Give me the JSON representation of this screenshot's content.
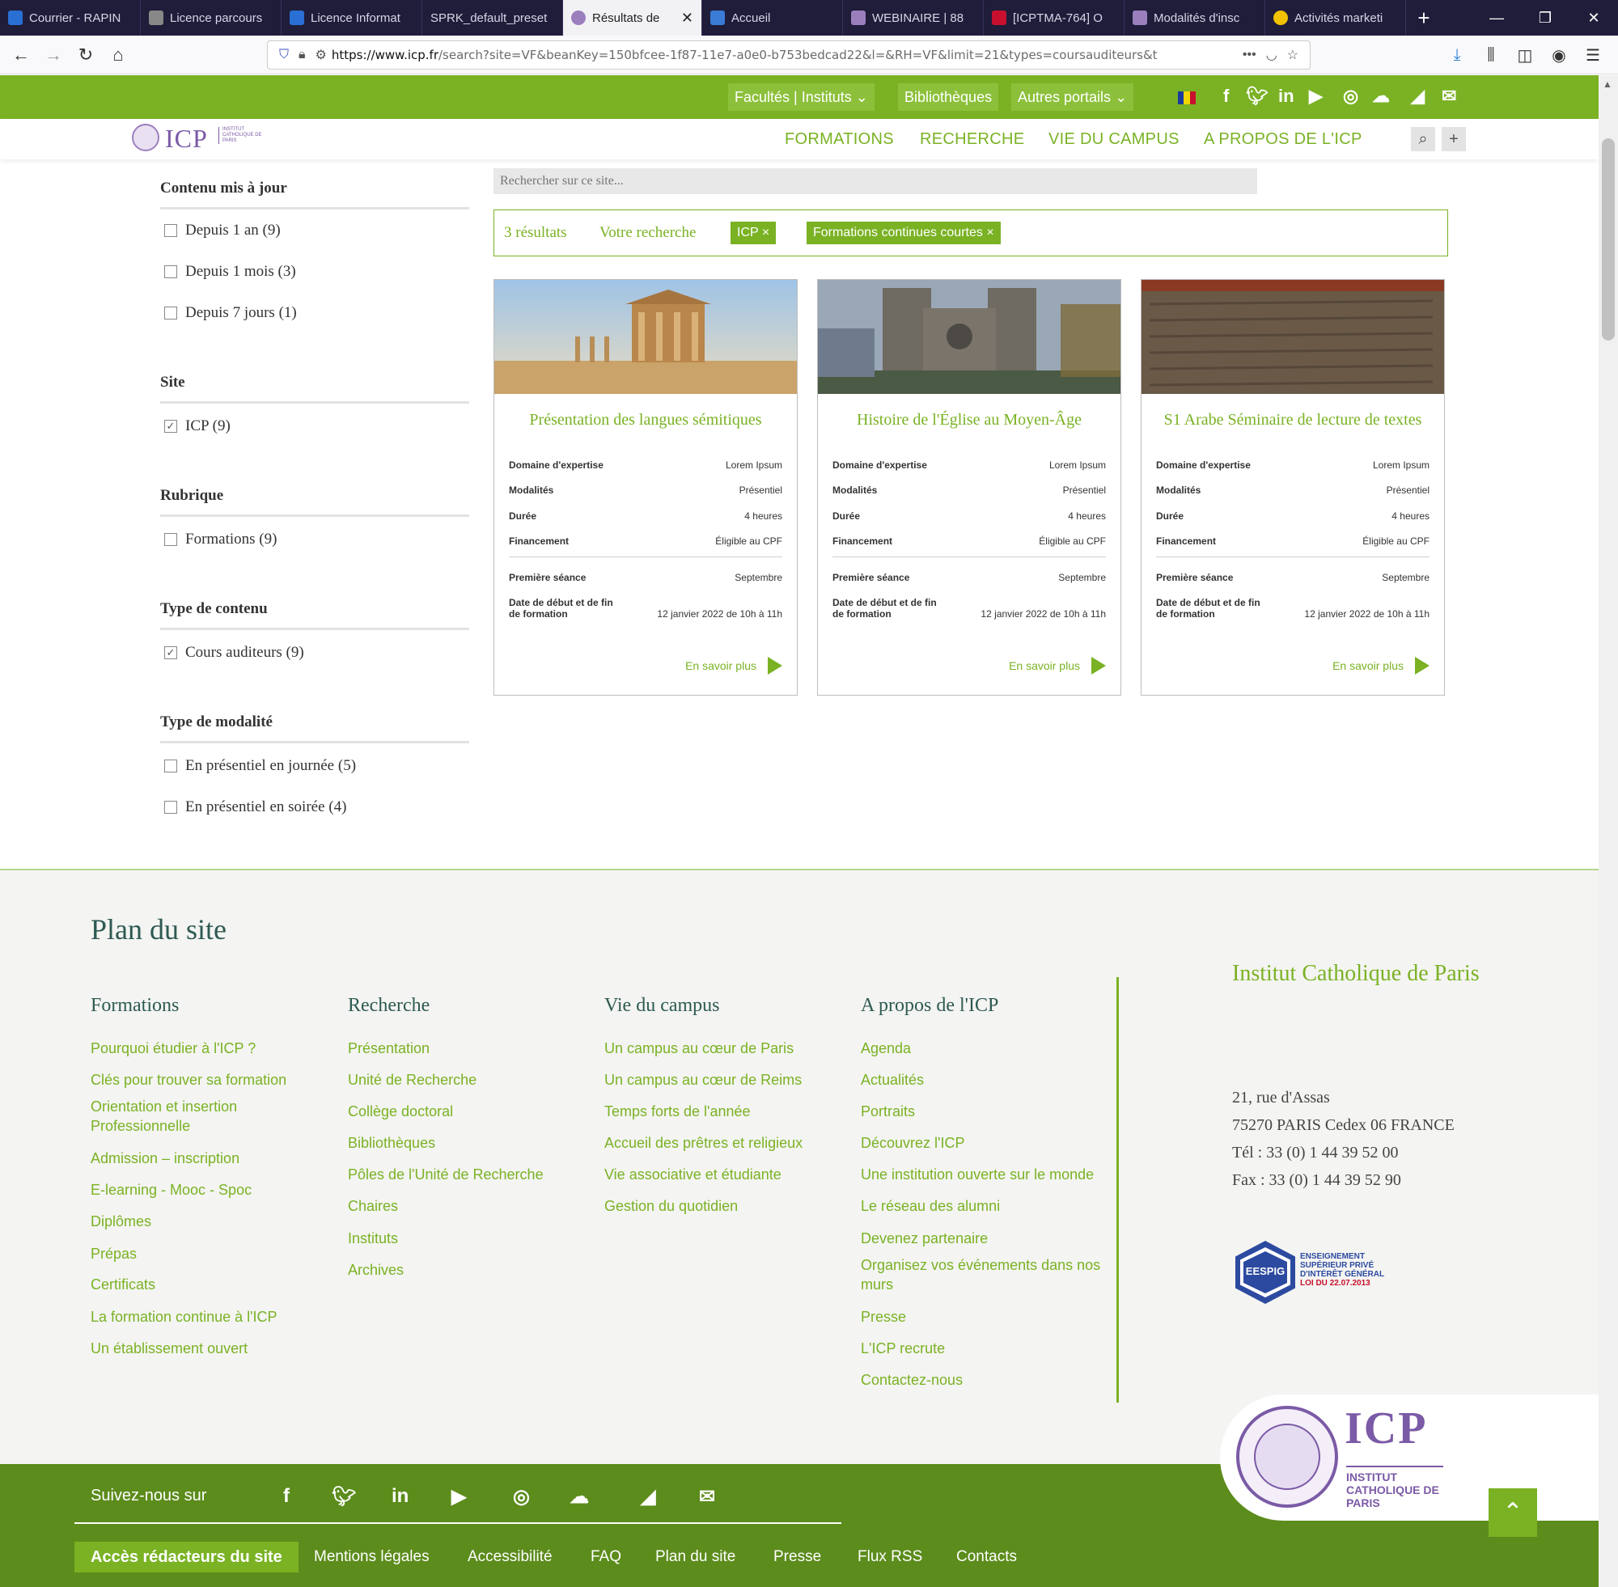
{
  "browser": {
    "tabs": [
      {
        "label": "Courrier - RAPIN",
        "color": "#2a6fd4"
      },
      {
        "label": "Licence parcours",
        "color": "#888888"
      },
      {
        "label": "Licence Informat",
        "color": "#2a6fd4"
      },
      {
        "label": "SPRK_default_preset",
        "color": "#1f1d3a"
      },
      {
        "label": "Résultats de",
        "color": "#9b7fbd"
      },
      {
        "label": "Accueil",
        "color": "#3a7bd5"
      },
      {
        "label": "WEBINAIRE | 88",
        "color": "#9b7fbd"
      },
      {
        "label": "[ICPTMA-764] O",
        "color": "#c8102e"
      },
      {
        "label": "Modalités d'insc",
        "color": "#9b7fbd"
      },
      {
        "label": "Activités marketi",
        "color": "#f2c200"
      }
    ],
    "url_domain": "https://www.icp.fr",
    "url_rest": "/search?site=VF&beanKey=150bfcee-1f87-11e7-a0e0-b753bedcad22&l=&RH=VF&limit=21&types=coursauditeurs&t"
  },
  "topbar": {
    "facultes": "Facultés | Instituts",
    "bibliotheques": "Bibliothèques",
    "autres": "Autres portails"
  },
  "header": {
    "logo": "ICP",
    "logo_sub": "INSTITUT CATHOLIQUE DE PARIS",
    "nav": [
      "FORMATIONS",
      "RECHERCHE",
      "VIE DU CAMPUS",
      "A PROPOS DE L'ICP"
    ]
  },
  "sidebar": {
    "groups": [
      {
        "title": "Contenu mis à jour",
        "items": [
          {
            "label": "Depuis 1 an (9)",
            "checked": false
          },
          {
            "label": "Depuis 1 mois (3)",
            "checked": false
          },
          {
            "label": "Depuis 7 jours (1)",
            "checked": false
          }
        ]
      },
      {
        "title": "Site",
        "items": [
          {
            "label": "ICP (9)",
            "checked": true
          }
        ]
      },
      {
        "title": "Rubrique",
        "items": [
          {
            "label": "Formations (9)",
            "checked": false
          }
        ]
      },
      {
        "title": "Type de contenu",
        "items": [
          {
            "label": "Cours auditeurs (9)",
            "checked": true
          }
        ]
      },
      {
        "title": "Type de modalité",
        "items": [
          {
            "label": "En présentiel en journée (5)",
            "checked": false
          },
          {
            "label": "En présentiel en soirée (4)",
            "checked": false
          }
        ]
      }
    ]
  },
  "search": {
    "placeholder": "Rechercher sur ce site..."
  },
  "results": {
    "count": "3 résultats",
    "label": "Votre recherche",
    "chips": [
      "ICP ×",
      "Formations continues courtes ×"
    ]
  },
  "cards": [
    {
      "title": "Présentation des langues sémitiques",
      "rows": [
        {
          "k": "Domaine d'expertise",
          "v": "Lorem Ipsum"
        },
        {
          "k": "Modalités",
          "v": "Présentiel"
        },
        {
          "k": "Durée",
          "v": "4 heures"
        },
        {
          "k": "Financement",
          "v": "Éligible au CPF"
        }
      ],
      "first_k": "Première séance",
      "first_v": "Septembre",
      "dates_k": "Date de début et de fin de formation",
      "dates_v": "12 janvier 2022 de 10h à 11h",
      "more": "En savoir plus"
    },
    {
      "title": "Histoire de l'Église au Moyen-Âge",
      "rows": [
        {
          "k": "Domaine d'expertise",
          "v": "Lorem Ipsum"
        },
        {
          "k": "Modalités",
          "v": "Présentiel"
        },
        {
          "k": "Durée",
          "v": "4 heures"
        },
        {
          "k": "Financement",
          "v": "Éligible au CPF"
        }
      ],
      "first_k": "Première séance",
      "first_v": "Septembre",
      "dates_k": "Date de début et de fin de formation",
      "dates_v": "12 janvier 2022 de 10h à 11h",
      "more": "En savoir plus"
    },
    {
      "title": "S1 Arabe Séminaire de lecture de textes",
      "rows": [
        {
          "k": "Domaine d'expertise",
          "v": "Lorem Ipsum"
        },
        {
          "k": "Modalités",
          "v": "Présentiel"
        },
        {
          "k": "Durée",
          "v": "4 heures"
        },
        {
          "k": "Financement",
          "v": "Éligible au CPF"
        }
      ],
      "first_k": "Première séance",
      "first_v": "Septembre",
      "dates_k": "Date de début et de fin de formation",
      "dates_v": "12 janvier 2022 de 10h à 11h",
      "more": "En savoir plus"
    }
  ],
  "footer": {
    "title": "Plan du site",
    "columns": [
      {
        "title": "Formations",
        "links": [
          "Pourquoi étudier à l'ICP ?",
          "Clés pour trouver sa formation",
          "Orientation et insertion Professionnelle",
          "Admission – inscription",
          "E-learning - Mooc - Spoc",
          "Diplômes",
          "Prépas",
          "Certificats",
          "La formation continue à l'ICP",
          "Un établissement ouvert"
        ]
      },
      {
        "title": "Recherche",
        "links": [
          "Présentation",
          "Unité de Recherche",
          "Collège doctoral",
          "Bibliothèques",
          "Pôles de l'Unité de Recherche",
          "Chaires",
          "Instituts",
          "Archives"
        ]
      },
      {
        "title": "Vie du campus",
        "links": [
          "Un campus au cœur de Paris",
          "Un campus au cœur de Reims",
          "Temps forts de l'année",
          "Accueil des prêtres et religieux",
          "Vie associative et étudiante",
          "Gestion du quotidien"
        ]
      },
      {
        "title": "A propos de l'ICP",
        "links": [
          "Agenda",
          "Actualités",
          "Portraits",
          "Découvrez l'ICP",
          "Une institution ouverte sur le monde",
          "Le réseau des alumni",
          "Devenez partenaire",
          "Organisez vos événements dans nos murs",
          "Presse",
          "L'ICP recrute",
          "Contactez-nous"
        ]
      }
    ],
    "institute": "Institut Catholique de Paris",
    "address": [
      "21, rue d'Assas",
      "75270 PARIS Cedex 06 FRANCE",
      "Tél : 33 (0) 1 44 39 52 00",
      "Fax : 33 (0) 1 44 39 52 90"
    ],
    "eespig_logo": "EESPIG",
    "eespig": [
      "ENSEIGNEMENT",
      "SUPÉRIEUR PRIVÉ",
      "D'INTÉRÊT GÉNÉRAL",
      "LOI DU 22.07.2013"
    ]
  },
  "bottom": {
    "follow": "Suivez-nous sur",
    "first": "Accès rédacteurs du site",
    "links": [
      "Mentions légales",
      "Accessibilité",
      "FAQ",
      "Plan du site",
      "Presse",
      "Flux RSS",
      "Contacts"
    ],
    "big_logo": "ICP",
    "big_sub": "INSTITUT CATHOLIQUE DE PARIS"
  }
}
